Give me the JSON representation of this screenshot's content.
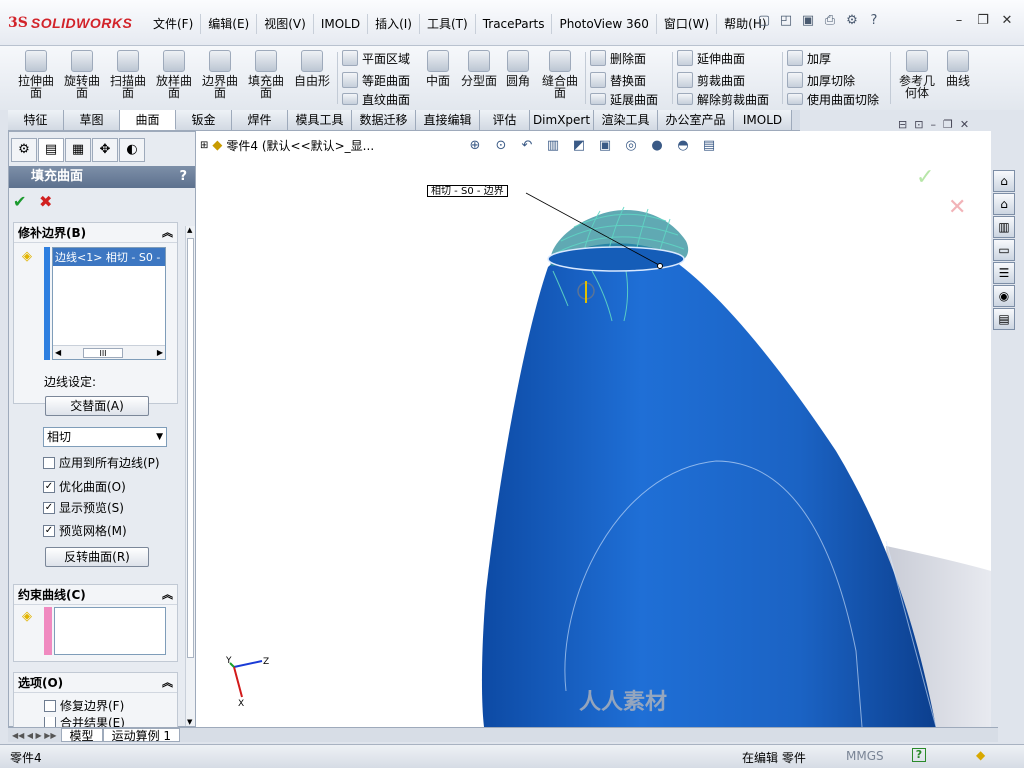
{
  "app": {
    "logo_ds": "3S",
    "logo_name": "SOLIDWORKS"
  },
  "menu": [
    "文件(F)",
    "编辑(E)",
    "视图(V)",
    "IMOLD",
    "插入(I)",
    "工具(T)",
    "TraceParts",
    "PhotoView 360",
    "窗口(W)",
    "帮助(H)"
  ],
  "toolbar_large": [
    {
      "label": "拉伸曲\n面",
      "icon": "extrude-surface-icon"
    },
    {
      "label": "旋转曲\n面",
      "icon": "revolve-surface-icon"
    },
    {
      "label": "扫描曲\n面",
      "icon": "sweep-surface-icon"
    },
    {
      "label": "放样曲\n面",
      "icon": "loft-surface-icon"
    },
    {
      "label": "边界曲\n面",
      "icon": "boundary-surface-icon"
    },
    {
      "label": "填充曲\n面",
      "icon": "fill-surface-icon"
    },
    {
      "label": "自由形",
      "icon": "freeform-icon"
    }
  ],
  "toolbar_small_a": [
    "平面区域",
    "等距曲面",
    "直纹曲面"
  ],
  "toolbar_mid": [
    {
      "label": "中面",
      "icon": "midsurface-icon"
    },
    {
      "label": "分型面",
      "icon": "parting-surface-icon"
    },
    {
      "label": "圆角",
      "icon": "fillet-icon"
    },
    {
      "label": "缝合曲\n面",
      "icon": "knit-surface-icon"
    }
  ],
  "toolbar_small_b": [
    "删除面",
    "替换面",
    "延展曲面"
  ],
  "toolbar_small_c": [
    "延伸曲面",
    "剪裁曲面",
    "解除剪裁曲面"
  ],
  "toolbar_small_d": [
    "加厚",
    "加厚切除",
    "使用曲面切除"
  ],
  "toolbar_right": [
    {
      "label": "参考几\n何体",
      "icon": "reference-geometry-icon"
    },
    {
      "label": "曲线",
      "icon": "curves-icon"
    }
  ],
  "tabs": [
    "特征",
    "草图",
    "曲面",
    "钣金",
    "焊件",
    "模具工具",
    "数据迁移",
    "直接编辑",
    "评估",
    "DimXpert",
    "渲染工具",
    "办公室产品",
    "IMOLD"
  ],
  "active_tab": "曲面",
  "pm": {
    "title": "填充曲面",
    "help": "?",
    "group_boundary": "修补边界(B)",
    "boundary_item": "边线<1> 相切 - S0 -",
    "scroll_thumb": "III",
    "edge_settings": "边线设定:",
    "alternate_face_btn": "交替面(A)",
    "contact_type": "相切",
    "apply_all": "应用到所有边线(P)",
    "optimize": "优化曲面(O)",
    "show_preview": "显示预览(S)",
    "preview_mesh": "预览网格(M)",
    "reverse_btn": "反转曲面(R)",
    "group_constraint": "约束曲线(C)",
    "group_options": "选项(O)",
    "fix_boundary": "修复边界(F)",
    "merge_result": "合并结果(E)"
  },
  "viewport": {
    "tree_label": "零件4 (默认<<默认>_显...",
    "callout": "相切 - S0 - 边界",
    "colors": {
      "body": "#1f6fd6",
      "body_dark": "#0f4ea8",
      "mesh": "#2fa59a",
      "edge": "#d9e9ff"
    }
  },
  "axes": {
    "x": "X",
    "y": "Y",
    "z": "Z"
  },
  "sheet_tabs": [
    "模型",
    "运动算例 1"
  ],
  "status": {
    "left": "零件4",
    "mid": "在编辑 零件",
    "units": "MMGS",
    "help": "?"
  },
  "watermark": "人人素材"
}
